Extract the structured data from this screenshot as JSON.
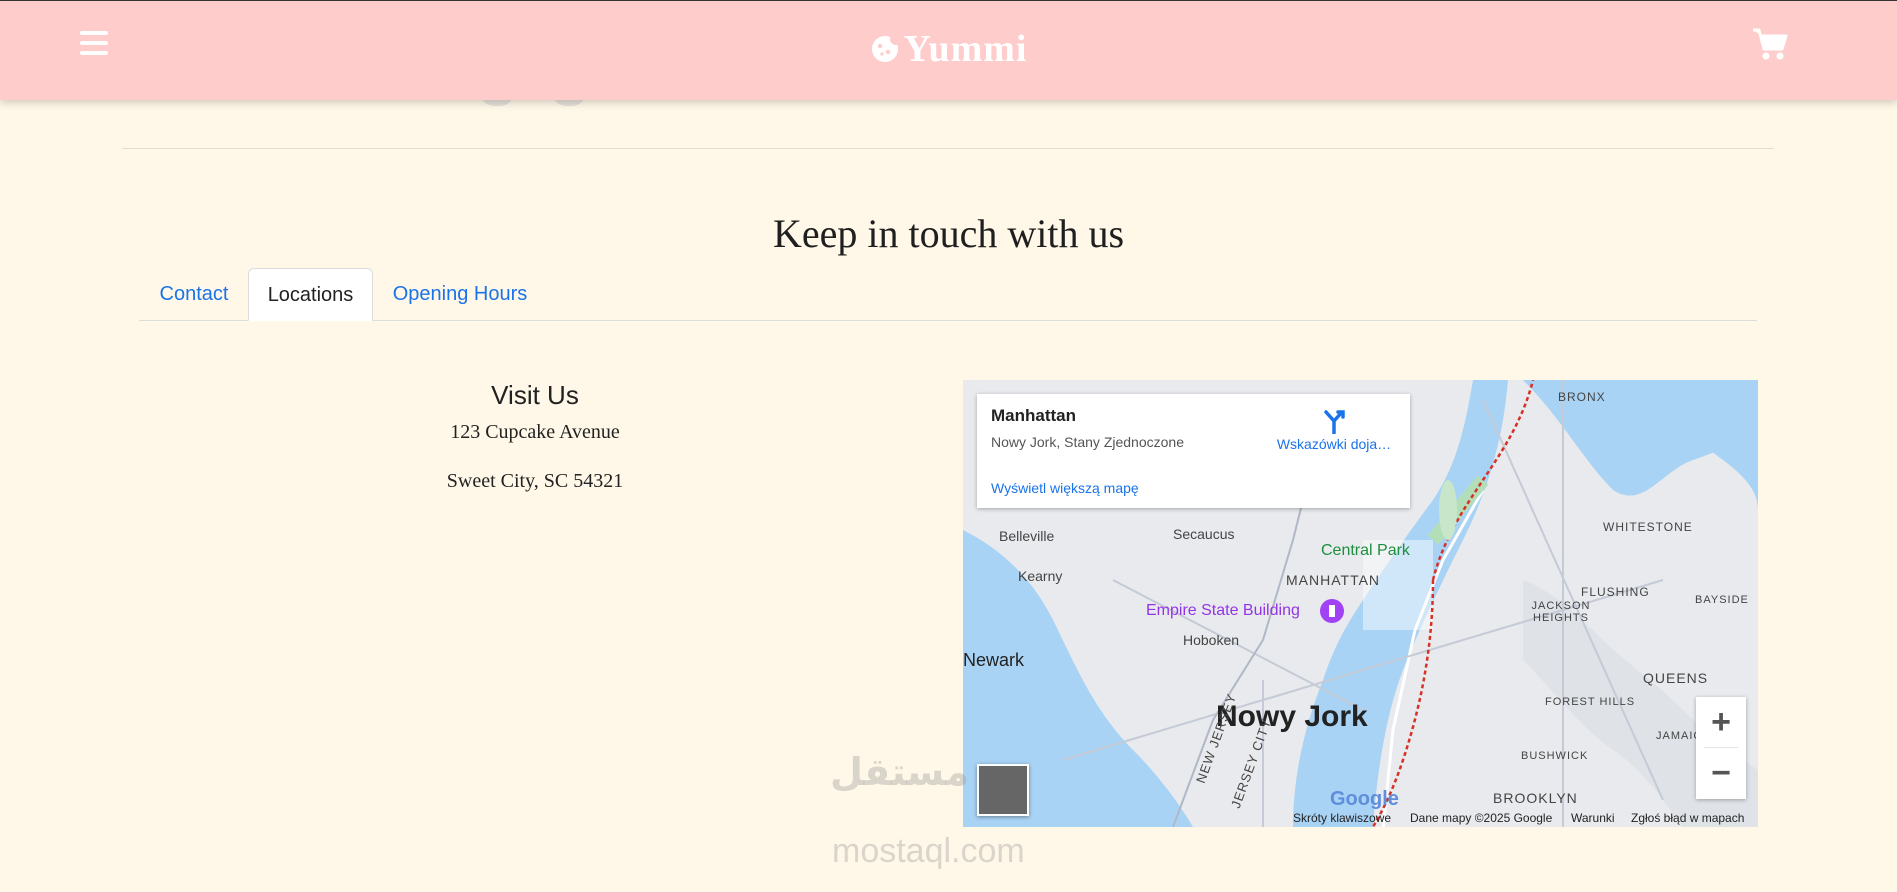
{
  "header": {
    "brand": "Yummi"
  },
  "section": {
    "title": "Keep in touch with us"
  },
  "tabs": [
    {
      "label": "Contact"
    },
    {
      "label": "Locations"
    },
    {
      "label": "Opening Hours"
    }
  ],
  "active_tab": "Locations",
  "visit": {
    "heading": "Visit Us",
    "address_line1": "123 Cupcake Avenue",
    "address_line2": "Sweet City, SC 54321"
  },
  "map": {
    "card": {
      "place": "Manhattan",
      "subtitle": "Nowy Jork, Stany Zjednoczone",
      "directions": "Wskazówki doja…",
      "bigger_map": "Wyświetl większą mapę"
    },
    "labels": {
      "city": "Nowy Jork",
      "manhattan": "MANHATTAN",
      "central_park": "Central Park",
      "empire": "Empire State Building",
      "bronx": "BRONX",
      "queens": "QUEENS",
      "brooklyn": "BROOKLYN",
      "newark": "Newark",
      "hoboken": "Hoboken",
      "secaucus": "Secaucus",
      "belleville": "Belleville",
      "kearny": "Kearny",
      "whitestone": "WHITESTONE",
      "flushing": "FLUSHING",
      "bayside": "BAYSIDE",
      "jackson_heights": "JACKSON HEIGHTS",
      "forest_hills": "FOREST HILLS",
      "bushwick": "BUSHWICK",
      "jamaica": "JAMAICA",
      "new_jersey": "NEW JERSEY",
      "jersey_city": "JERSEY CITY"
    },
    "footer": {
      "shortcuts": "Skróty klawiszowe",
      "data": "Dane mapy ©2025 Google",
      "terms": "Warunki",
      "report": "Zgłoś błąd w mapach"
    },
    "google": "Google"
  },
  "watermark": {
    "arabic": "مستقل",
    "site": "mostaql.com"
  }
}
